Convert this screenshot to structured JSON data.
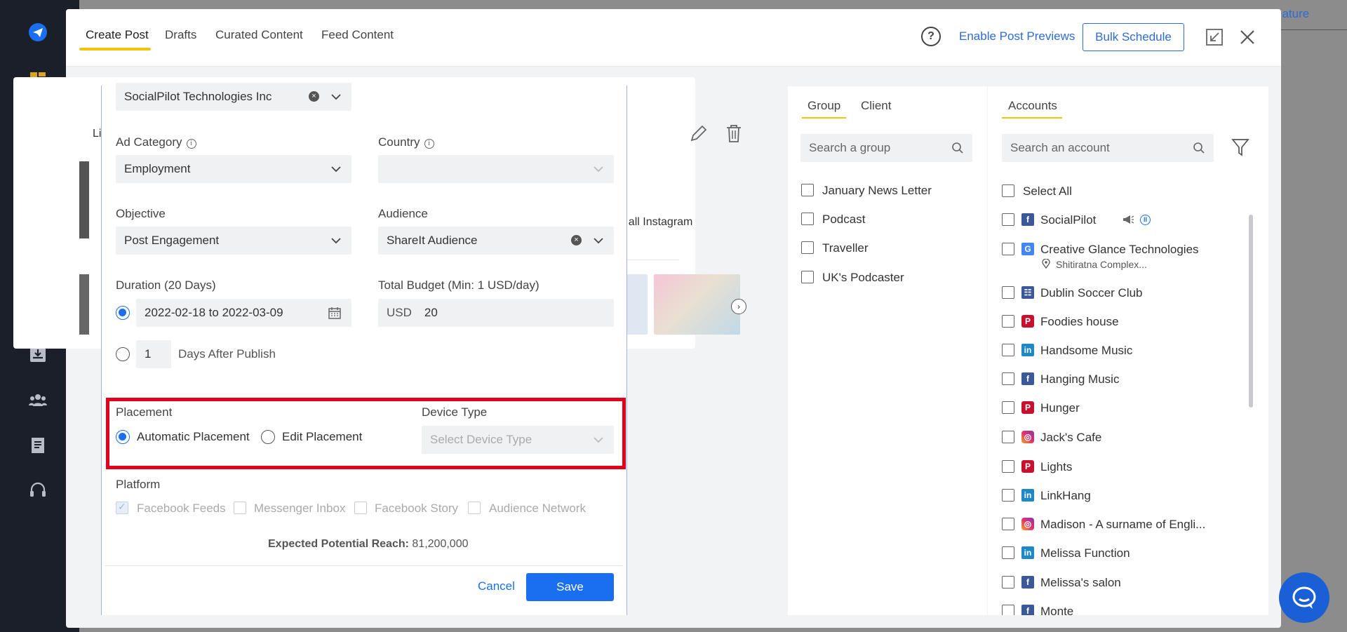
{
  "header": {
    "tabs": [
      {
        "label": "Create Post",
        "active": true
      },
      {
        "label": "Drafts",
        "active": false
      },
      {
        "label": "Curated Content",
        "active": false
      },
      {
        "label": "Feed Content",
        "active": false
      }
    ],
    "help_glyph": "?",
    "enable_previews": "Enable Post Previews",
    "bulk_schedule": "Bulk Schedule"
  },
  "background": {
    "feature_text": "eature",
    "left_label": "Li",
    "instagram_text": "et all Instagram"
  },
  "form": {
    "page_select": "SocialPilot Technologies Inc",
    "ad_category": {
      "label": "Ad Category",
      "value": "Employment"
    },
    "country": {
      "label": "Country",
      "value": ""
    },
    "objective": {
      "label": "Objective",
      "value": "Post Engagement"
    },
    "audience": {
      "label": "Audience",
      "value": "ShareIt Audience"
    },
    "duration": {
      "label": "Duration (20 Days)",
      "date_range": "2022-02-18 to 2022-03-09",
      "days_value": "1",
      "days_after_label": "Days After Publish"
    },
    "budget": {
      "label": "Total Budget (Min: 1 USD/day)",
      "currency": "USD",
      "value": "20"
    },
    "placement": {
      "label": "Placement",
      "automatic": "Automatic Placement",
      "edit": "Edit Placement",
      "selected": "automatic"
    },
    "device_type": {
      "label": "Device Type",
      "placeholder": "Select Device Type"
    },
    "platform": {
      "label": "Platform",
      "options": [
        {
          "label": "Facebook Feeds",
          "checked": true
        },
        {
          "label": "Messenger Inbox",
          "checked": false
        },
        {
          "label": "Facebook Story",
          "checked": false
        },
        {
          "label": "Audience Network",
          "checked": false
        }
      ]
    },
    "reach_label": "Expected Potential Reach:",
    "reach_value": "81,200,000",
    "cancel": "Cancel",
    "save": "Save"
  },
  "groups": {
    "tabs": [
      "Group",
      "Client"
    ],
    "search_placeholder": "Search a group",
    "items": [
      "January News Letter",
      "Podcast",
      "Traveller",
      "UK's Podcaster"
    ]
  },
  "accounts": {
    "tab": "Accounts",
    "search_placeholder": "Search an account",
    "select_all": "Select All",
    "items": [
      {
        "name": "SocialPilot",
        "network": "facebook"
      },
      {
        "name": "Creative Glance Technologies",
        "network": "google-business",
        "location": "Shitiratna Complex..."
      },
      {
        "name": "Dublin Soccer Club",
        "network": "facebook-group"
      },
      {
        "name": "Foodies house",
        "network": "pinterest"
      },
      {
        "name": "Handsome Music",
        "network": "linkedin"
      },
      {
        "name": "Hanging Music",
        "network": "facebook"
      },
      {
        "name": "Hunger",
        "network": "pinterest"
      },
      {
        "name": "Jack's Cafe",
        "network": "instagram"
      },
      {
        "name": "Lights",
        "network": "pinterest"
      },
      {
        "name": "LinkHang",
        "network": "linkedin"
      },
      {
        "name": "Madison - A surname of Engli...",
        "network": "instagram"
      },
      {
        "name": "Melissa Function",
        "network": "linkedin"
      },
      {
        "name": "Melissa's salon",
        "network": "facebook"
      },
      {
        "name": "Monte",
        "network": "facebook"
      }
    ]
  },
  "colors": {
    "accent": "#1a6ff0",
    "tab_underline": "#f4c20d",
    "highlight": "#e3001b",
    "sidebar": "#1b1f2a"
  }
}
